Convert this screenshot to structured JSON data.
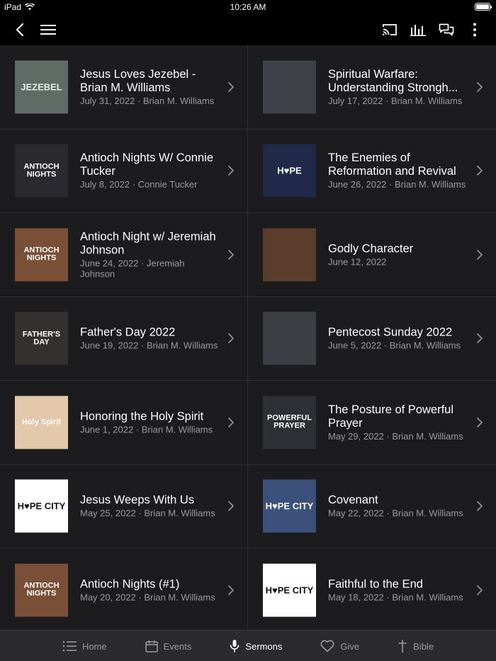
{
  "status": {
    "device": "iPad",
    "time": "10:26 AM"
  },
  "nav": {
    "back_icon": "chevron-left-icon",
    "menu_icon": "hamburger-icon",
    "cast_icon": "cast-icon",
    "audio_icon": "equalizer-icon",
    "chat_icon": "chat-icon",
    "more_icon": "more-vertical-icon"
  },
  "sermons": [
    {
      "title": "Jesus Loves Jezebel - Brian M. Williams",
      "meta": "July 31, 2022 · Brian M. Williams",
      "thumb_text": "JEZEBEL",
      "thumb_bg": "#5f6b64",
      "thumb_fg": "#e8ece8"
    },
    {
      "title": "Spiritual Warfare: Understanding Strongh...",
      "meta": "July 17, 2022 · Brian M. Williams",
      "thumb_text": "",
      "thumb_bg": "#3d4148",
      "thumb_fg": "#ffffff"
    },
    {
      "title": "Antioch Nights W/ Connie Tucker",
      "meta": "July 8, 2022 · Connie Tucker",
      "thumb_text": "ANTIOCH NIGHTS",
      "thumb_bg": "#2a2a2e",
      "thumb_fg": "#ffffff"
    },
    {
      "title": "The Enemies of Reformation and Revival",
      "meta": "June 26, 2022 · Brian M. Williams",
      "thumb_text": "H♥PE",
      "thumb_bg": "#1f2a48",
      "thumb_fg": "#ffffff"
    },
    {
      "title": "Antioch Night w/ Jeremiah Johnson",
      "meta": "June 24, 2022 · Jeremiah Johnson",
      "thumb_text": "ANTIOCH NIGHTS",
      "thumb_bg": "#7a4f38",
      "thumb_fg": "#ffffff"
    },
    {
      "title": "Godly Character",
      "meta": "June 12, 2022",
      "thumb_text": "",
      "thumb_bg": "#5a3e2b",
      "thumb_fg": "#ffffff"
    },
    {
      "title": "Father's Day 2022",
      "meta": "June 19, 2022 · Brian M. Williams",
      "thumb_text": "FATHER'S DAY",
      "thumb_bg": "#33312e",
      "thumb_fg": "#ffffff"
    },
    {
      "title": "Pentecost Sunday 2022",
      "meta": "June 5, 2022 · Brian M. Williams",
      "thumb_text": "",
      "thumb_bg": "#3b3f44",
      "thumb_fg": "#ffffff"
    },
    {
      "title": "Honoring the Holy Spirit",
      "meta": "June 1, 2022 · Brian M. Williams",
      "thumb_text": "Holy Spirit",
      "thumb_bg": "#e3c7aa",
      "thumb_fg": "#ffffff"
    },
    {
      "title": "The Posture of Powerful Prayer",
      "meta": "May 29, 2022 · Brian M. Williams",
      "thumb_text": "POWERFUL PRAYER",
      "thumb_bg": "#2c2f33",
      "thumb_fg": "#ffffff"
    },
    {
      "title": "Jesus Weeps With Us",
      "meta": "May 25, 2022 · Brian M. Williams",
      "thumb_text": "H♥PE CITY",
      "thumb_bg": "#ffffff",
      "thumb_fg": "#111111"
    },
    {
      "title": "Covenant",
      "meta": "May 22, 2022 · Brian M. Williams",
      "thumb_text": "H♥PE CITY",
      "thumb_bg": "#3a4f7a",
      "thumb_fg": "#ffffff"
    },
    {
      "title": "Antioch Nights (#1)",
      "meta": "May 20, 2022 · Brian M. Williams",
      "thumb_text": "ANTIOCH NIGHTS",
      "thumb_bg": "#7a4f38",
      "thumb_fg": "#ffffff"
    },
    {
      "title": "Faithful to the End",
      "meta": "May 18, 2022 · Brian M. Williams",
      "thumb_text": "H♥PE CITY",
      "thumb_bg": "#ffffff",
      "thumb_fg": "#111111"
    }
  ],
  "tabs": [
    {
      "label": "Home",
      "icon": "list-icon",
      "active": false
    },
    {
      "label": "Events",
      "icon": "calendar-icon",
      "active": false
    },
    {
      "label": "Sermons",
      "icon": "microphone-icon",
      "active": true
    },
    {
      "label": "Give",
      "icon": "heart-icon",
      "active": false
    },
    {
      "label": "Bible",
      "icon": "cross-icon",
      "active": false
    }
  ],
  "colors": {
    "background": "#1c1c1e",
    "bar": "#000000",
    "tab_bar": "#2b2b2e",
    "meta_text": "#9a9a9e"
  }
}
